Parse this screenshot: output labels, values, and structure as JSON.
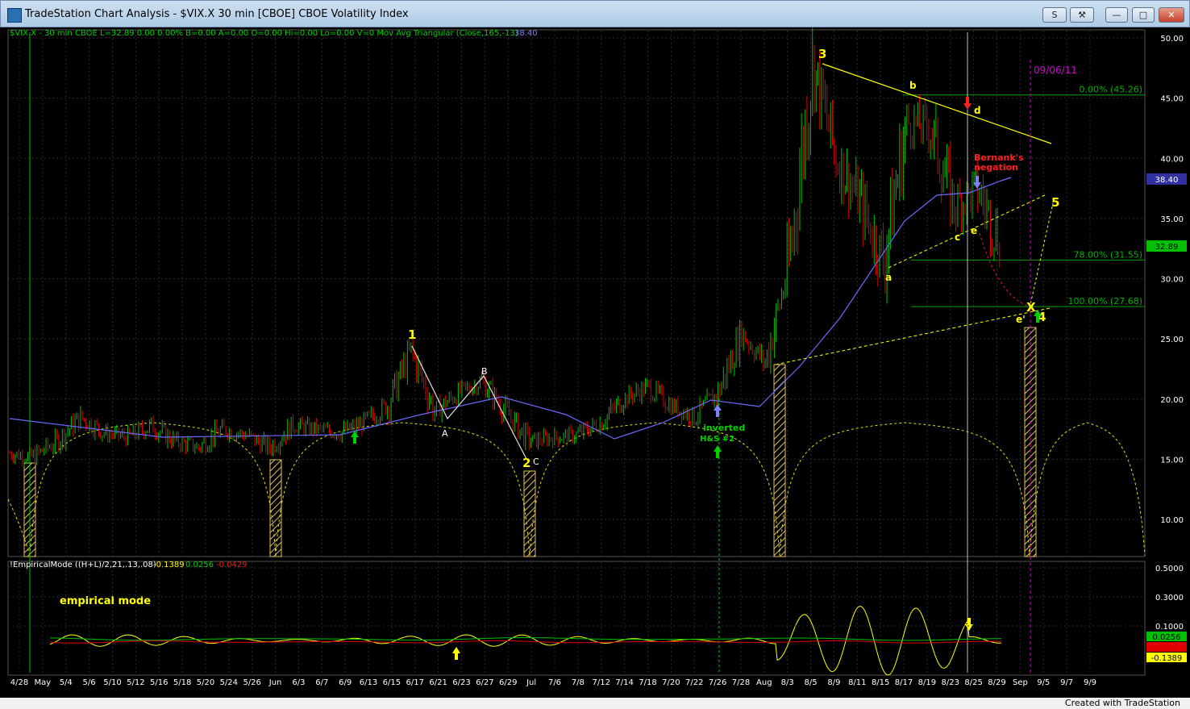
{
  "window": {
    "title": "TradeStation Chart Analysis - $VIX.X 30 min [CBOE] CBOE Volatility Index",
    "buttons": {
      "s_label": "S",
      "tool_label": "⚒",
      "min_label": "—",
      "max_label": "□",
      "close_label": "✕"
    }
  },
  "header": {
    "symbol_info": "$VIX.X - 30 min  CBOE  L=32.89  0.00  0.00%  B=0.00  A=0.00  O=0.00  Hi=0.00  Lo=0.00  V=0  Mov Avg Triangular (Close,165,-13)",
    "ma_value": "38.40"
  },
  "price_axis": {
    "ticks": [
      "50.00",
      "45.00",
      "40.00",
      "35.00",
      "30.00",
      "25.00",
      "20.00",
      "15.00",
      "10.00"
    ],
    "last_price": "32.89",
    "ma_price": "38.40"
  },
  "fib_levels": [
    {
      "label": "0.00% (45.26)",
      "value": 45.26
    },
    {
      "label": "78.00% (31.55)",
      "value": 31.55
    },
    {
      "label": "100.00% (27.68)",
      "value": 27.68
    }
  ],
  "date_label": "09/06/11",
  "annotation_bernanke": "Bernank's\nnegation",
  "wave_labels": {
    "w1": "1",
    "w2": "2",
    "w3": "3",
    "w4": "4",
    "w5": "5",
    "A": "A",
    "B": "B",
    "C": "C",
    "a": "a",
    "b": "b",
    "c": "c",
    "d": "d",
    "e": "e",
    "e2": "e'",
    "x": "X",
    "inverted": "inverted",
    "hs": "H&S  #2"
  },
  "indicator": {
    "header": "!EmpiricalMode ((H+L)/2,21,.13,.08)",
    "values": [
      "-0.1389",
      "0.0256",
      "-0.0429"
    ],
    "title": "empirical mode",
    "ticks": [
      "0.5000",
      "0.3000",
      "0.1000",
      "0.0256",
      "-0.1389"
    ]
  },
  "x_axis": {
    "labels": [
      "4/28",
      "May",
      "5/4",
      "5/6",
      "5/10",
      "5/12",
      "5/16",
      "5/18",
      "5/20",
      "5/24",
      "5/26",
      "Jun",
      "6/3",
      "6/7",
      "6/9",
      "6/13",
      "6/15",
      "6/17",
      "6/21",
      "6/23",
      "6/27",
      "6/29",
      "Jul",
      "7/6",
      "7/8",
      "7/12",
      "7/14",
      "7/18",
      "7/20",
      "7/22",
      "7/26",
      "7/28",
      "Aug",
      "8/3",
      "8/5",
      "8/9",
      "8/11",
      "8/15",
      "8/17",
      "8/19",
      "8/23",
      "8/25",
      "8/29",
      "Sep",
      "9/5",
      "9/7",
      "9/9"
    ]
  },
  "footer": {
    "credit": "Created with TradeStation"
  },
  "colors": {
    "background": "#000000",
    "up_bar": "#00c000",
    "down_bar": "#e00000",
    "ma": "#6a6aff",
    "fib": "#00a000",
    "wave": "#ffff00",
    "annotation": "#ff2020",
    "date_marker": "#cc00cc"
  },
  "chart_data": {
    "type": "line",
    "title": "CBOE Volatility Index",
    "series": [
      {
        "name": "$VIX.X",
        "x": [
          "4/28",
          "May",
          "5/4",
          "5/6",
          "5/10",
          "5/12",
          "5/16",
          "5/18",
          "5/20",
          "5/24",
          "5/26",
          "Jun",
          "6/3",
          "6/7",
          "6/9",
          "6/13",
          "6/15",
          "6/17",
          "6/21",
          "6/23",
          "6/27",
          "6/29",
          "Jul",
          "7/6",
          "7/8",
          "7/12",
          "7/14",
          "7/18",
          "7/20",
          "7/22",
          "7/26",
          "7/28",
          "Aug",
          "8/3",
          "8/5",
          "8/9",
          "8/11",
          "8/15",
          "8/17",
          "8/19",
          "8/23",
          "8/25",
          "8/29"
        ],
        "values": [
          15.5,
          15.2,
          16.5,
          18.5,
          17.2,
          16.8,
          17.8,
          16.5,
          16.0,
          17.5,
          17.0,
          16.0,
          17.8,
          17.5,
          17.2,
          18.0,
          19.5,
          24.0,
          19.0,
          20.5,
          21.5,
          19.0,
          16.5,
          16.8,
          17.0,
          18.0,
          20.0,
          21.0,
          19.5,
          18.5,
          20.5,
          25.5,
          23.0,
          31.0,
          48.0,
          40.0,
          36.5,
          31.5,
          43.0,
          42.5,
          36.0,
          37.5,
          32.89
        ]
      }
    ],
    "ylim": [
      7,
      51
    ]
  }
}
